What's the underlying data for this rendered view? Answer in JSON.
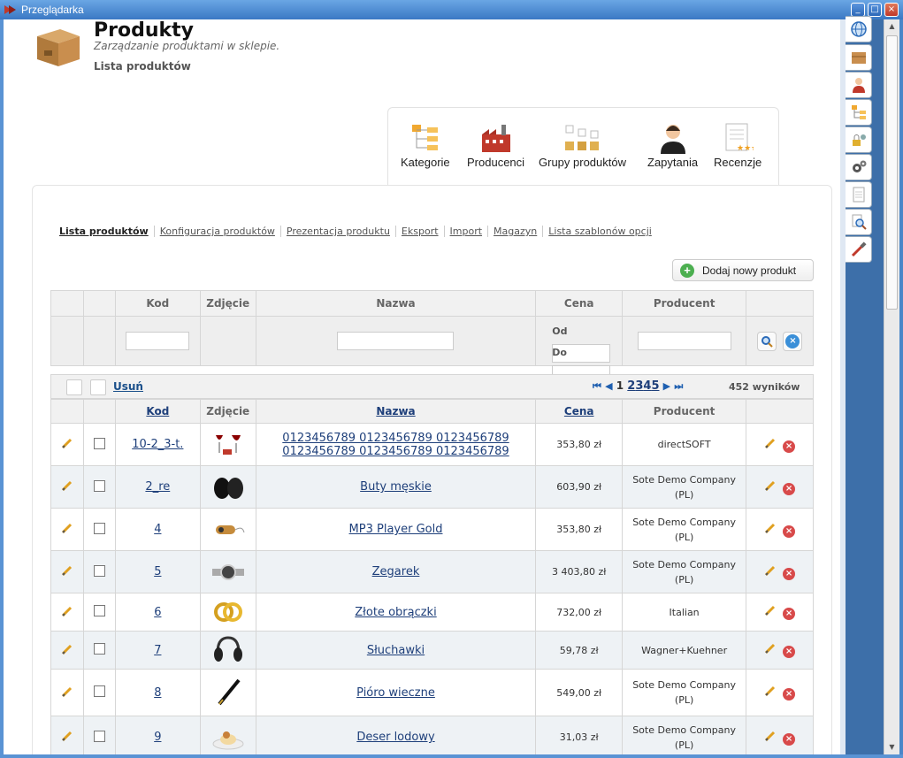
{
  "window": {
    "title": "Przeglądarka"
  },
  "header": {
    "title": "Produkty",
    "subtitle": "Zarządzanie produktami w sklepie.",
    "section": "Lista produktów"
  },
  "modules": [
    {
      "label": "Kategorie",
      "icon": "category-tree-icon"
    },
    {
      "label": "Producenci",
      "icon": "factory-icon"
    },
    {
      "label": "Grupy produktów",
      "icon": "product-groups-icon"
    },
    {
      "label": "Zapytania",
      "icon": "support-agent-icon"
    },
    {
      "label": "Recenzje",
      "icon": "reviews-icon"
    }
  ],
  "subtabs": [
    "Lista produktów",
    "Konfiguracja produktów",
    "Prezentacja produktu",
    "Eksport",
    "Import",
    "Magazyn",
    "Lista szablonów opcji"
  ],
  "add_button": "Dodaj nowy produkt",
  "filter": {
    "headers": [
      "Kod",
      "Zdjęcie",
      "Nazwa",
      "Cena",
      "Producent"
    ],
    "price_from": "Od",
    "price_to": "Do"
  },
  "toolbar": {
    "delete": "Usuń",
    "pages": [
      "1",
      "2",
      "3",
      "4",
      "5"
    ],
    "results": "452 wyników"
  },
  "list_headers": [
    "Kod",
    "Zdjęcie",
    "Nazwa",
    "Cena",
    "Producent"
  ],
  "rows": [
    {
      "code": "10-2_3-t.",
      "image": "wine-glasses",
      "name_l1": "0123456789 0123456789 0123456789",
      "name_l2": "0123456789 0123456789 0123456789",
      "price": "353,80 zł",
      "producer_l1": "directSOFT",
      "producer_l2": ""
    },
    {
      "code": "2_re",
      "image": "shoes",
      "name_l1": "Buty męskie",
      "name_l2": "",
      "price": "603,90 zł",
      "producer_l1": "Sote Demo Company",
      "producer_l2": "(PL)"
    },
    {
      "code": "4",
      "image": "mp3-player",
      "name_l1": "MP3 Player Gold",
      "name_l2": "",
      "price": "353,80 zł",
      "producer_l1": "Sote Demo Company",
      "producer_l2": "(PL)"
    },
    {
      "code": "5",
      "image": "watch",
      "name_l1": "Zegarek",
      "name_l2": "",
      "price": "3 403,80 zł",
      "producer_l1": "Sote Demo Company",
      "producer_l2": "(PL)"
    },
    {
      "code": "6",
      "image": "rings",
      "name_l1": "Złote obrączki",
      "name_l2": "",
      "price": "732,00 zł",
      "producer_l1": "Italian",
      "producer_l2": ""
    },
    {
      "code": "7",
      "image": "headphones",
      "name_l1": "Słuchawki",
      "name_l2": "",
      "price": "59,78 zł",
      "producer_l1": "Wagner+Kuehner",
      "producer_l2": ""
    },
    {
      "code": "8",
      "image": "pen",
      "name_l1": "Pióro wieczne",
      "name_l2": "",
      "price": "549,00 zł",
      "producer_l1": "Sote Demo Company",
      "producer_l2": "(PL)"
    },
    {
      "code": "9",
      "image": "dessert",
      "name_l1": "Deser lodowy",
      "name_l2": "",
      "price": "31,03 zł",
      "producer_l1": "Sote Demo Company",
      "producer_l2": "(PL)"
    }
  ],
  "sidebar_icons": [
    "globe-icon",
    "box-icon",
    "user-icon",
    "tree-icon",
    "lock-user-icon",
    "gears-icon",
    "document-icon",
    "magnifier-icon",
    "tools-icon"
  ],
  "colors": {
    "link": "#1e3f7a",
    "title_bar": "#3a78c4",
    "delete": "#d84a4a",
    "add": "#4caf50"
  }
}
